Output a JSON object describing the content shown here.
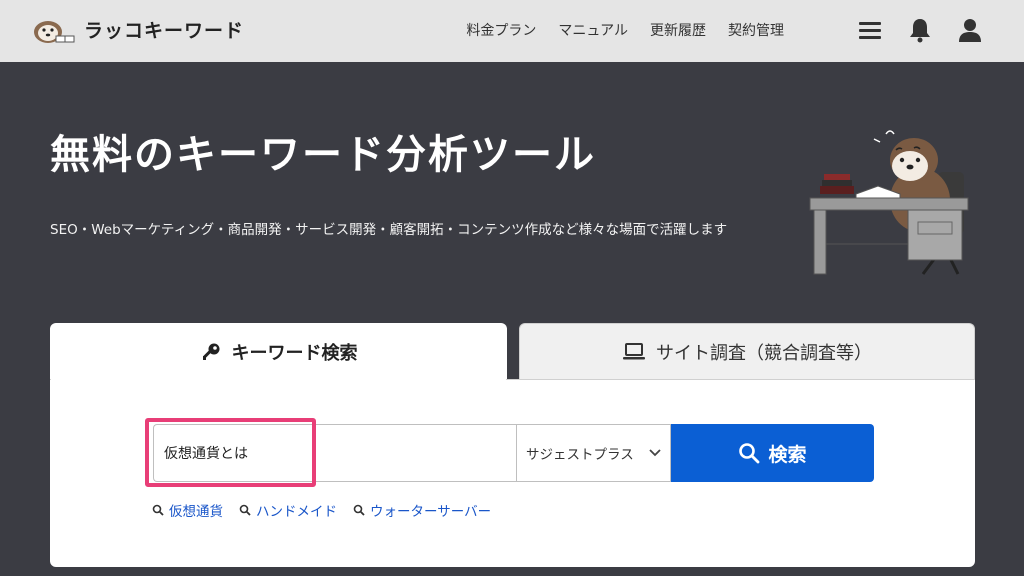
{
  "header": {
    "brand": "ラッコキーワード",
    "nav": [
      "料金プラン",
      "マニュアル",
      "更新履歴",
      "契約管理"
    ],
    "icons": [
      "menu-icon",
      "bell-icon",
      "user-icon"
    ]
  },
  "hero": {
    "title": "無料のキーワード分析ツール",
    "description": "SEO・Webマーケティング・商品開発・サービス開発・顧客開拓・コンテンツ作成など様々な場面で活躍します"
  },
  "tabs": {
    "keyword": "キーワード検索",
    "site": "サイト調査（競合調査等）"
  },
  "search": {
    "value": "仮想通貨とは",
    "mode": "サジェストプラス",
    "button": "検索"
  },
  "suggestions": [
    "仮想通貨",
    "ハンドメイド",
    "ウォーターサーバー"
  ],
  "colors": {
    "background": "#3b3c43",
    "header": "#e5e5e5",
    "primary_button": "#0b5fd4",
    "highlight": "#e83e77",
    "link": "#1a56c9"
  }
}
